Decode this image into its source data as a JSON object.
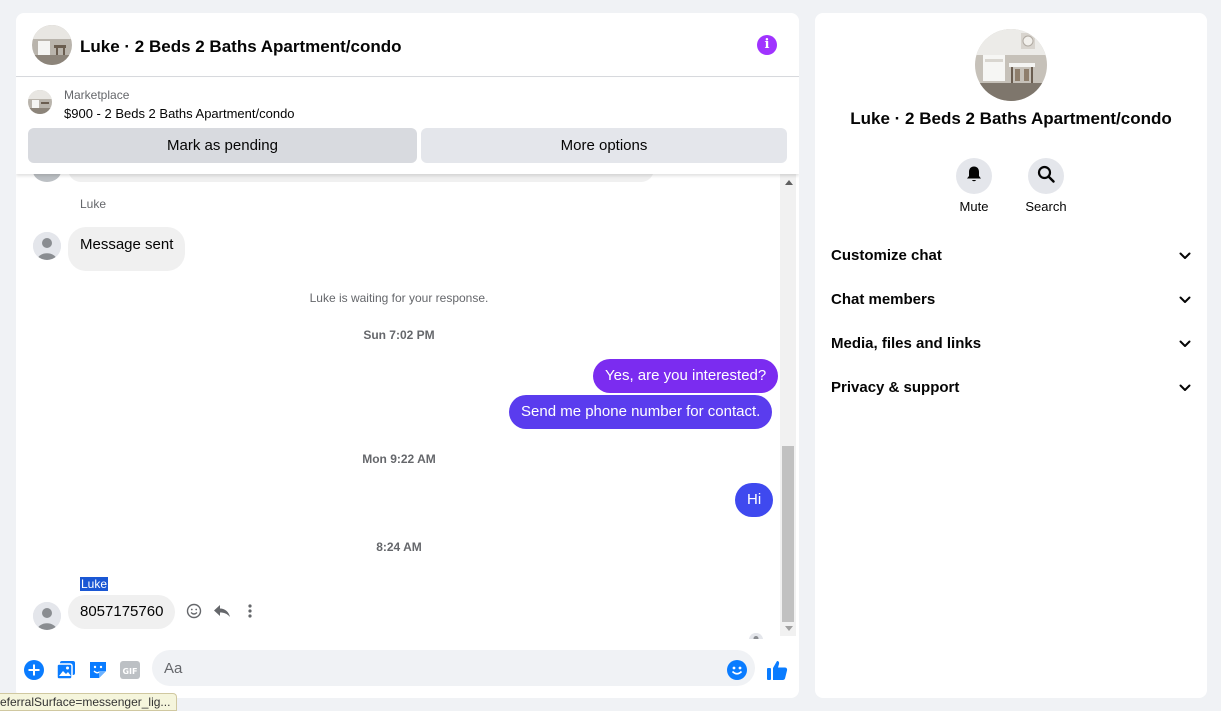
{
  "header": {
    "title": "Luke · 2 Beds 2 Baths Apartment/condo",
    "info_icon": "i"
  },
  "listing": {
    "category": "Marketplace",
    "title": "$900 - 2 Beds 2 Baths Apartment/condo",
    "pending_label": "Mark as pending",
    "more_label": "More options"
  },
  "thread": {
    "messages": [
      {
        "sender": "Luke",
        "text": "Message sent"
      },
      {
        "notice": "Luke is waiting for your response."
      },
      {
        "timestamp": "Sun 7:02 PM"
      },
      {
        "text": "Yes, are you interested?"
      },
      {
        "text": "Send me phone number for contact."
      },
      {
        "timestamp": "Mon 9:22 AM"
      },
      {
        "text": "Hi"
      },
      {
        "timestamp": "8:24 AM"
      },
      {
        "sender": "Luke",
        "text": "8057175760"
      }
    ]
  },
  "composer": {
    "placeholder": "Aa"
  },
  "info": {
    "title": "Luke · 2 Beds 2 Baths Apartment/condo",
    "mute_label": "Mute",
    "search_label": "Search",
    "sections": [
      {
        "label": "Customize chat"
      },
      {
        "label": "Chat members"
      },
      {
        "label": "Media, files and links"
      },
      {
        "label": "Privacy & support"
      }
    ]
  },
  "status_bar": {
    "text": "eferralSurface=messenger_lig..."
  },
  "colors": {
    "outgoing_purple": "#7b2cf0",
    "outgoing_blue": "#3f49ef",
    "accent": "#0a7cff",
    "info": "#a033ff"
  }
}
